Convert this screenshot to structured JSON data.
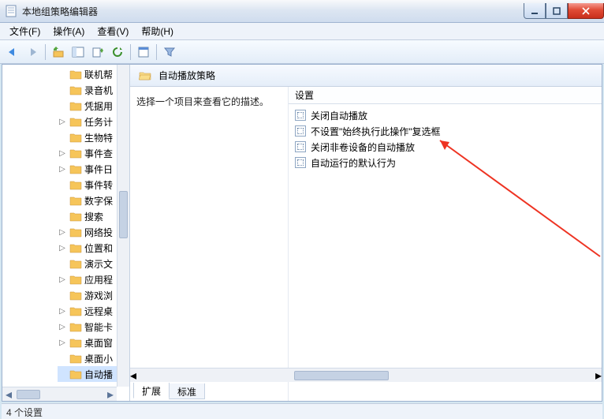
{
  "window": {
    "title": "本地组策略编辑器"
  },
  "menu": {
    "file": "文件(F)",
    "action": "操作(A)",
    "view": "查看(V)",
    "help": "帮助(H)"
  },
  "header": {
    "title": "自动播放策略"
  },
  "desc": {
    "prompt": "选择一个项目来查看它的描述。"
  },
  "list": {
    "col_setting": "设置",
    "items": [
      "关闭自动播放",
      "不设置\"始终执行此操作\"复选框",
      "关闭非卷设备的自动播放",
      "自动运行的默认行为"
    ]
  },
  "tree": {
    "items": [
      "联机帮",
      "录音机",
      "凭据用",
      "任务计",
      "生物特",
      "事件查",
      "事件日",
      "事件转",
      "数字保",
      "搜索",
      "网络投",
      "位置和",
      "演示文",
      "应用程",
      "游戏浏",
      "远程桌",
      "智能卡",
      "桌面窗",
      "桌面小",
      "自动播"
    ],
    "expandable": [
      3,
      5,
      6,
      10,
      11,
      13,
      15,
      16,
      17
    ],
    "selected": 19
  },
  "tabs": {
    "ext": "扩展",
    "std": "标准"
  },
  "status": {
    "text": "4 个设置"
  }
}
